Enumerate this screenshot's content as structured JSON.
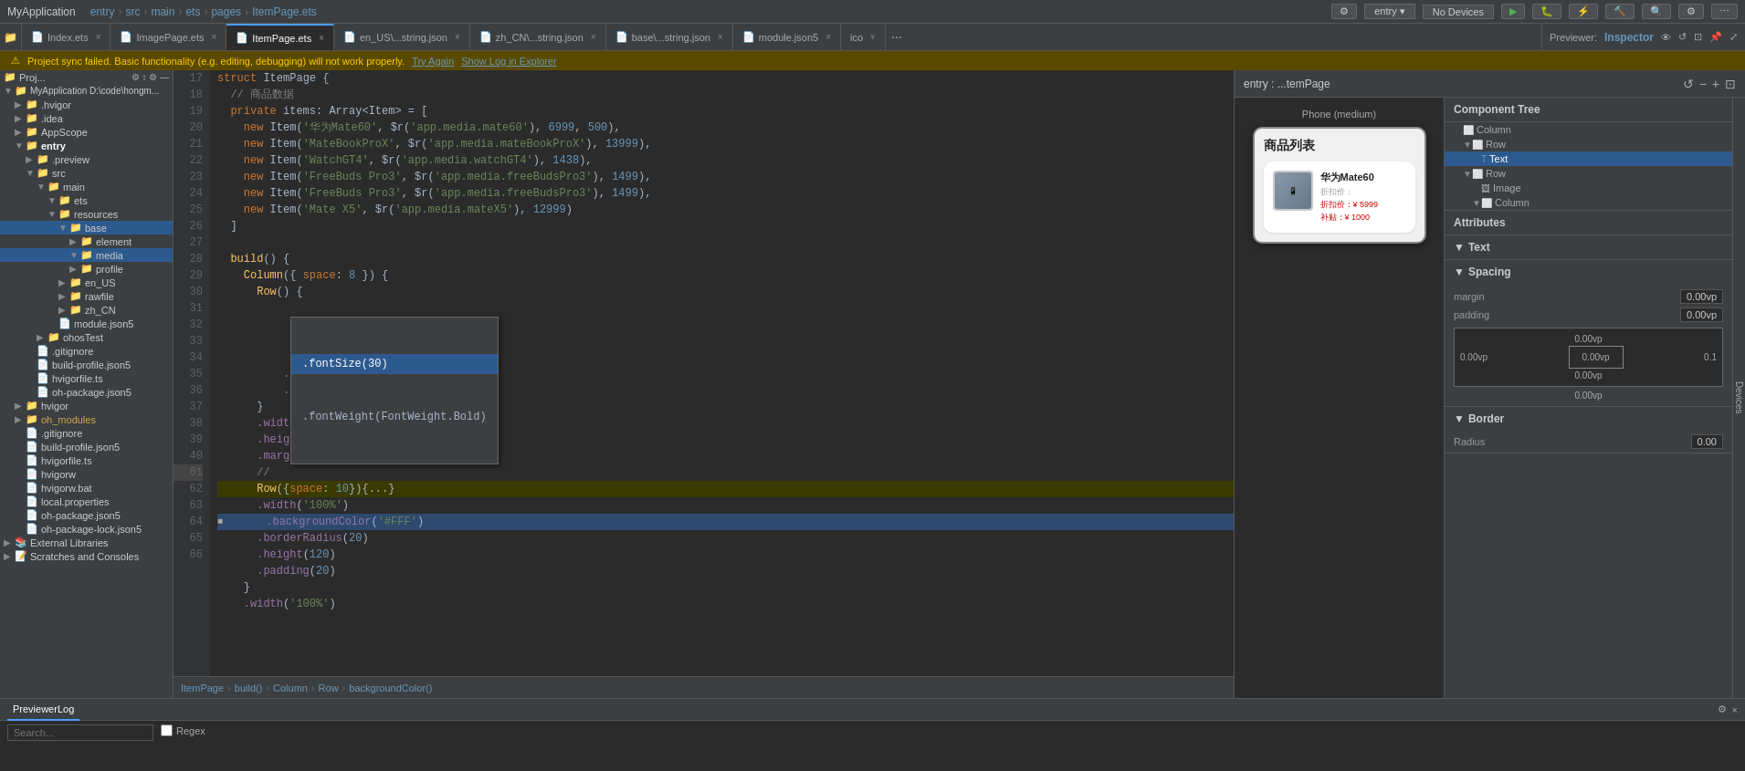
{
  "app": {
    "title": "MyApplication",
    "breadcrumb": [
      "entry",
      "src",
      "main",
      "ets",
      "pages",
      "ItemPage.ets"
    ]
  },
  "tabs": [
    {
      "label": "Index.ets",
      "active": false,
      "closable": true
    },
    {
      "label": "ImagePage.ets",
      "active": false,
      "closable": true
    },
    {
      "label": "ItemPage.ets",
      "active": true,
      "closable": true
    },
    {
      "label": "en_US\\...string.json",
      "active": false,
      "closable": true
    },
    {
      "label": "zh_CN\\...string.json",
      "active": false,
      "closable": true
    },
    {
      "label": "base\\...string.json",
      "active": false,
      "closable": true
    },
    {
      "label": "module.json5",
      "active": false,
      "closable": true
    },
    {
      "label": "ico",
      "active": false,
      "closable": false
    }
  ],
  "warning": {
    "text": "Project sync failed. Basic functionality (e.g. editing, debugging) will not work properly.",
    "try_again": "Try Again",
    "show_log": "Show Log in Explorer"
  },
  "right_panel": {
    "previewer_label": "Previewer:",
    "inspector_label": "Inspector",
    "entry_label": "entry : ...temPage",
    "phone_label": "Phone (medium)",
    "devices_label": "Devices",
    "no_devices": "No Devices"
  },
  "component_tree": {
    "title": "Component Tree",
    "items": [
      {
        "label": "Column",
        "indent": 0,
        "arrow": "",
        "icon": "□"
      },
      {
        "label": "Row",
        "indent": 1,
        "arrow": "▼",
        "icon": "□"
      },
      {
        "label": "Text",
        "indent": 2,
        "arrow": "",
        "icon": "T",
        "selected": true
      },
      {
        "label": "Row",
        "indent": 1,
        "arrow": "▼",
        "icon": "□"
      },
      {
        "label": "Image",
        "indent": 2,
        "arrow": "",
        "icon": "🖼"
      },
      {
        "label": "Column",
        "indent": 2,
        "arrow": "▼",
        "icon": "□"
      }
    ]
  },
  "attributes": {
    "title": "Attributes",
    "text_section": "Text",
    "spacing_section": "Spacing",
    "border_section": "Border",
    "margin_label": "margin",
    "margin_value": "0.00vp",
    "padding_label": "padding",
    "padding_value": "0.00vp",
    "padding_values": [
      "0.00vp",
      "0.00vp",
      "0.00vp",
      "0.1",
      "0.00vp",
      "0.00vp"
    ],
    "radius_label": "Radius",
    "radius_value": "0.00"
  },
  "code_lines": [
    {
      "num": 17,
      "content": "struct ItemPage {",
      "tokens": [
        {
          "t": "kw",
          "v": "struct"
        },
        {
          "t": "plain",
          "v": " ItemPage {"
        }
      ]
    },
    {
      "num": 18,
      "content": "  // 商品数据",
      "tokens": [
        {
          "t": "comment",
          "v": "  // 商品数据"
        }
      ]
    },
    {
      "num": 19,
      "content": "  private items: Array<Item> = [",
      "tokens": [
        {
          "t": "kw",
          "v": "  private"
        },
        {
          "t": "plain",
          "v": " items: Array<Item> = ["
        }
      ]
    },
    {
      "num": 20,
      "content": "    new Item('华为Mate60', $r('app.media.mate60'), 6999, 500),",
      "tokens": [
        {
          "t": "plain",
          "v": "    "
        },
        {
          "t": "kw",
          "v": "new"
        },
        {
          "t": "plain",
          "v": " Item("
        },
        {
          "t": "str",
          "v": "'华为Mate60'"
        },
        {
          "t": "plain",
          "v": ", $r("
        },
        {
          "t": "str",
          "v": "'app.media.mate60'"
        },
        {
          "t": "plain",
          "v": "), "
        },
        {
          "t": "num",
          "v": "6999"
        },
        {
          "t": "plain",
          "v": ", "
        },
        {
          "t": "num",
          "v": "500"
        },
        {
          "t": "plain",
          "v": ",)"
        }
      ]
    },
    {
      "num": 21,
      "content": "    new Item('MateBookProX', $r('app.media.mateBookProX'), 13999),",
      "tokens": [
        {
          "t": "plain",
          "v": "    "
        },
        {
          "t": "kw",
          "v": "new"
        },
        {
          "t": "plain",
          "v": " Item("
        },
        {
          "t": "str",
          "v": "'MateBookProX'"
        },
        {
          "t": "plain",
          "v": ", $r("
        },
        {
          "t": "str",
          "v": "'app.media.mateBookProX'"
        },
        {
          "t": "plain",
          "v": "), "
        },
        {
          "t": "num",
          "v": "13999"
        },
        {
          "t": "plain",
          "v": ",)"
        }
      ]
    },
    {
      "num": 22,
      "content": "    new Item('WatchGT4', $r('app.media.watchGT4'), 1438),",
      "tokens": [
        {
          "t": "plain",
          "v": "    "
        },
        {
          "t": "kw",
          "v": "new"
        },
        {
          "t": "plain",
          "v": " Item("
        },
        {
          "t": "str",
          "v": "'WatchGT4'"
        },
        {
          "t": "plain",
          "v": ", $r("
        },
        {
          "t": "str",
          "v": "'app.media.watchGT4'"
        },
        {
          "t": "plain",
          "v": "), "
        },
        {
          "t": "num",
          "v": "1438"
        },
        {
          "t": "plain",
          "v": ",)"
        }
      ]
    },
    {
      "num": 23,
      "content": "    new Item('FreeBuds Pro3', $r('app.media.freeBudsPro3'), 1499),",
      "tokens": []
    },
    {
      "num": 24,
      "content": "    new Item('FreeBuds Pro3', $r('app.media.freeBudsPro3'), 1499),",
      "tokens": []
    },
    {
      "num": 25,
      "content": "    new Item('Mate X5', $r('app.media.mateX5'), 12999)",
      "tokens": []
    },
    {
      "num": 26,
      "content": "  ]",
      "tokens": []
    },
    {
      "num": 27,
      "content": "",
      "tokens": []
    },
    {
      "num": 28,
      "content": "  build() {",
      "tokens": [
        {
          "t": "fn",
          "v": "  build"
        },
        {
          "t": "plain",
          "v": "() {"
        }
      ]
    },
    {
      "num": 29,
      "content": "    Column({ space: 8 }) {",
      "tokens": [
        {
          "t": "fn",
          "v": "    Column"
        },
        {
          "t": "plain",
          "v": "({ "
        },
        {
          "t": "kw",
          "v": "space"
        },
        {
          "t": "plain",
          "v": ": "
        },
        {
          "t": "num",
          "v": "8"
        },
        {
          "t": "plain",
          "v": " }) {"
        }
      ]
    },
    {
      "num": 30,
      "content": "      Row() {",
      "tokens": [
        {
          "t": "fn",
          "v": "      Row"
        },
        {
          "t": "plain",
          "v": "() {"
        }
      ]
    },
    {
      "num": 31,
      "content": "        Text('商品列表')",
      "tokens": [
        {
          "t": "fn",
          "v": "        Text"
        },
        {
          "t": "plain",
          "v": "("
        },
        {
          "t": "str",
          "v": "'商品列表'"
        },
        {
          "t": "plain",
          "v": ")"
        }
      ]
    },
    {
      "num": 32,
      "content": "          .fontSize(30)",
      "tokens": [
        {
          "t": "prop",
          "v": "          .fontSize"
        },
        {
          "t": "plain",
          "v": "("
        },
        {
          "t": "num",
          "v": "30"
        },
        {
          "t": "plain",
          "v": ")"
        }
      ]
    },
    {
      "num": 33,
      "content": "          .fontWeight(FontWeight.Bold)",
      "tokens": [
        {
          "t": "prop",
          "v": "          .fontWeight"
        },
        {
          "t": "plain",
          "v": "("
        },
        {
          "t": "type",
          "v": "FontWeight"
        },
        {
          "t": "plain",
          "v": ".Bold)"
        }
      ]
    },
    {
      "num": 34,
      "content": "      }",
      "tokens": [
        {
          "t": "plain",
          "v": "      }"
        }
      ]
    },
    {
      "num": 35,
      "content": "      .width('100%')",
      "tokens": [
        {
          "t": "prop",
          "v": "      .width"
        },
        {
          "t": "plain",
          "v": "("
        },
        {
          "t": "str",
          "v": "'100%'"
        },
        {
          "t": "plain",
          "v": ")"
        }
      ]
    },
    {
      "num": 36,
      "content": "      .height(30)",
      "tokens": [
        {
          "t": "prop",
          "v": "      .height"
        },
        {
          "t": "plain",
          "v": "("
        },
        {
          "t": "num",
          "v": "30"
        },
        {
          "t": "plain",
          "v": ")"
        }
      ]
    },
    {
      "num": 37,
      "content": "      .margin({ bottom: 20 })",
      "tokens": [
        {
          "t": "prop",
          "v": "      .margin"
        },
        {
          "t": "plain",
          "v": "({ "
        },
        {
          "t": "kw",
          "v": "bottom"
        },
        {
          "t": "plain",
          "v": ": "
        },
        {
          "t": "num",
          "v": "20"
        },
        {
          "t": "plain",
          "v": " })"
        }
      ]
    },
    {
      "num": 38,
      "content": "      //",
      "tokens": [
        {
          "t": "comment",
          "v": "      //"
        }
      ]
    },
    {
      "num": 39,
      "content": "      Row({space: 10}){...}",
      "tokens": [
        {
          "t": "fn",
          "v": "      Row"
        },
        {
          "t": "plain",
          "v": "({"
        },
        {
          "t": "kw",
          "v": "space"
        },
        {
          "t": "plain",
          "v": ": "
        },
        {
          "t": "num",
          "v": "10"
        },
        {
          "t": "plain",
          "v": "}){...}"
        }
      ]
    },
    {
      "num": 40,
      "content": "      .width('100%')",
      "tokens": [
        {
          "t": "prop",
          "v": "      .width"
        },
        {
          "t": "plain",
          "v": "("
        },
        {
          "t": "str",
          "v": "'100%'"
        },
        {
          "t": "plain",
          "v": ")"
        }
      ]
    },
    {
      "num": 61,
      "content": "      .backgroundColor('#FFF')",
      "tokens": [
        {
          "t": "prop",
          "v": "      .backgroundColor"
        },
        {
          "t": "plain",
          "v": "("
        },
        {
          "t": "str",
          "v": "'#FFF'"
        },
        {
          "t": "plain",
          "v": ")"
        }
      ],
      "current": true
    },
    {
      "num": 62,
      "content": "      .borderRadius(20)",
      "tokens": [
        {
          "t": "prop",
          "v": "      .borderRadius"
        },
        {
          "t": "plain",
          "v": "("
        },
        {
          "t": "num",
          "v": "20"
        },
        {
          "t": "plain",
          "v": ")"
        }
      ]
    },
    {
      "num": 63,
      "content": "      .height(120)",
      "tokens": [
        {
          "t": "prop",
          "v": "      .height"
        },
        {
          "t": "plain",
          "v": "("
        },
        {
          "t": "num",
          "v": "120"
        },
        {
          "t": "plain",
          "v": ")"
        }
      ]
    },
    {
      "num": 64,
      "content": "      .padding(20)",
      "tokens": [
        {
          "t": "prop",
          "v": "      .padding"
        },
        {
          "t": "plain",
          "v": "("
        },
        {
          "t": "num",
          "v": "20"
        },
        {
          "t": "plain",
          "v": ")"
        }
      ]
    },
    {
      "num": 65,
      "content": "    }",
      "tokens": [
        {
          "t": "plain",
          "v": "    }"
        }
      ]
    },
    {
      "num": 66,
      "content": "    .width('100%')",
      "tokens": [
        {
          "t": "prop",
          "v": "    .width"
        },
        {
          "t": "plain",
          "v": "("
        },
        {
          "t": "str",
          "v": "'100%'"
        },
        {
          "t": "plain",
          "v": ")"
        }
      ]
    }
  ],
  "breadcrumb_bar": {
    "items": [
      "ItemPage",
      "build()",
      "Column",
      "Row",
      "backgroundColor()"
    ]
  },
  "file_tree": {
    "items": [
      {
        "label": "Proj...",
        "indent": 0,
        "type": "project",
        "arrow": "▼"
      },
      {
        "label": "MyApplication D:\\code\\hongm...",
        "indent": 0,
        "type": "root",
        "arrow": "▼"
      },
      {
        "label": ".hvigor",
        "indent": 1,
        "type": "folder",
        "arrow": "▶"
      },
      {
        "label": ".idea",
        "indent": 1,
        "type": "folder",
        "arrow": "▶"
      },
      {
        "label": "AppScope",
        "indent": 1,
        "type": "folder",
        "arrow": "▶"
      },
      {
        "label": "entry",
        "indent": 1,
        "type": "folder",
        "arrow": "▼",
        "bold": true
      },
      {
        "label": ".preview",
        "indent": 2,
        "type": "folder",
        "arrow": "▶"
      },
      {
        "label": "src",
        "indent": 2,
        "type": "folder",
        "arrow": "▼"
      },
      {
        "label": "main",
        "indent": 3,
        "type": "folder",
        "arrow": "▼"
      },
      {
        "label": "ets",
        "indent": 4,
        "type": "folder",
        "arrow": "▼"
      },
      {
        "label": "resources",
        "indent": 4,
        "type": "folder",
        "arrow": "▼"
      },
      {
        "label": "base",
        "indent": 5,
        "type": "folder",
        "arrow": "▼",
        "selected": true
      },
      {
        "label": "element",
        "indent": 6,
        "type": "folder",
        "arrow": "▶"
      },
      {
        "label": "media",
        "indent": 6,
        "type": "folder",
        "arrow": "▼",
        "selected": true
      },
      {
        "label": "profile",
        "indent": 6,
        "type": "folder",
        "arrow": "▶"
      },
      {
        "label": "en_US",
        "indent": 5,
        "type": "folder",
        "arrow": "▶"
      },
      {
        "label": "rawfile",
        "indent": 5,
        "type": "folder",
        "arrow": "▶"
      },
      {
        "label": "zh_CN",
        "indent": 5,
        "type": "folder",
        "arrow": "▶"
      },
      {
        "label": "module.json5",
        "indent": 4,
        "type": "file"
      },
      {
        "label": "ohosTest",
        "indent": 3,
        "type": "folder",
        "arrow": "▶"
      },
      {
        "label": ".gitignore",
        "indent": 2,
        "type": "file"
      },
      {
        "label": "build-profile.json5",
        "indent": 2,
        "type": "file"
      },
      {
        "label": "hvigorfile.ts",
        "indent": 2,
        "type": "file"
      },
      {
        "label": "oh-package.json5",
        "indent": 2,
        "type": "file"
      },
      {
        "label": "hvigor",
        "indent": 1,
        "type": "folder",
        "arrow": "▶"
      },
      {
        "label": "oh_modules",
        "indent": 1,
        "type": "folder",
        "arrow": "▶"
      },
      {
        "label": ".gitignore",
        "indent": 1,
        "type": "file"
      },
      {
        "label": "build-profile.json5",
        "indent": 1,
        "type": "file"
      },
      {
        "label": "hvigorfile.ts",
        "indent": 1,
        "type": "file"
      },
      {
        "label": "hvigorw",
        "indent": 1,
        "type": "file"
      },
      {
        "label": "hvigorw.bat",
        "indent": 1,
        "type": "file"
      },
      {
        "label": "local.properties",
        "indent": 1,
        "type": "file"
      },
      {
        "label": "oh-package.json5",
        "indent": 1,
        "type": "file"
      },
      {
        "label": "oh-package-lock.json5",
        "indent": 1,
        "type": "file"
      },
      {
        "label": "External Libraries",
        "indent": 0,
        "type": "folder",
        "arrow": "▶"
      },
      {
        "label": "Scratches and Consoles",
        "indent": 0,
        "type": "folder",
        "arrow": "▶"
      }
    ]
  },
  "bottom": {
    "tab_label": "PreviewerLog",
    "search_placeholder": "Search...",
    "regex_label": "Regex"
  },
  "product": {
    "title": "商品列表",
    "name": "华为Mate60",
    "original_price": "折扣价：¥5999",
    "discount_price": "折扣价：¥ 5999",
    "subsidy": "补贴：¥ 1000"
  }
}
